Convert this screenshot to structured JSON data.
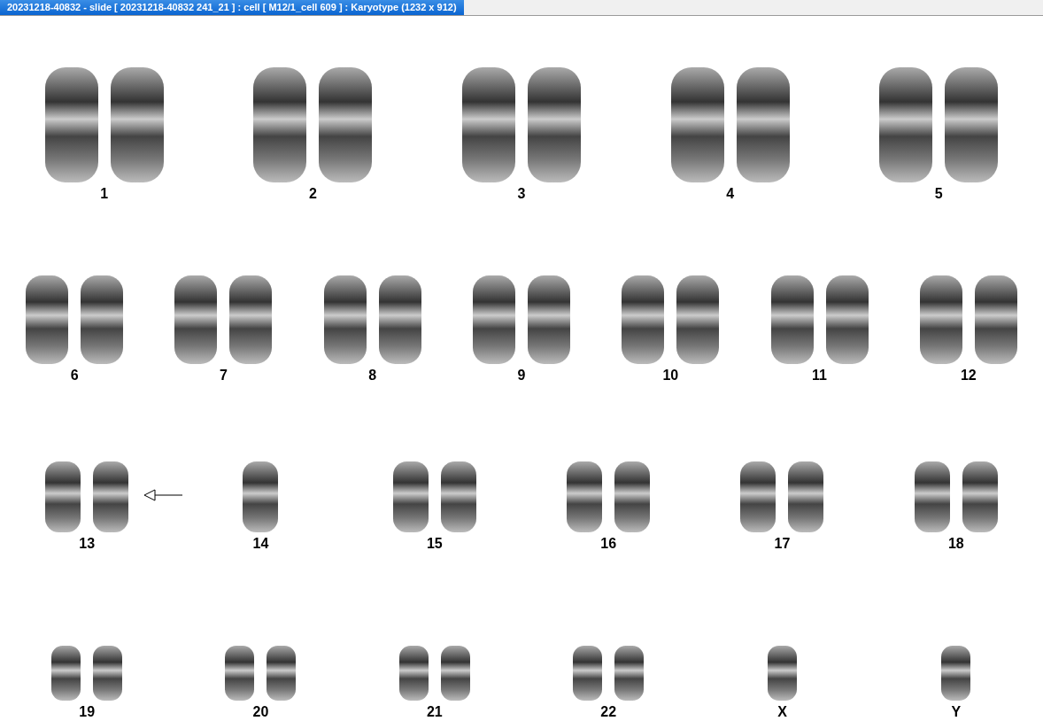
{
  "window": {
    "title": "20231218-40832 - slide [ 20231218-40832 241_21 ] : cell [ M12/1_cell 609 ] : Karyotype  (1232 x 912)"
  },
  "karyotype": {
    "rows": [
      {
        "items": [
          {
            "label": "1",
            "kind": "pair",
            "marked": false
          },
          {
            "label": "2",
            "kind": "pair",
            "marked": false
          },
          {
            "label": "3",
            "kind": "pair",
            "marked": false
          },
          {
            "label": "4",
            "kind": "pair",
            "marked": false
          },
          {
            "label": "5",
            "kind": "pair",
            "marked": false
          }
        ]
      },
      {
        "items": [
          {
            "label": "6",
            "kind": "pair",
            "marked": false
          },
          {
            "label": "7",
            "kind": "pair",
            "marked": false
          },
          {
            "label": "8",
            "kind": "pair",
            "marked": false
          },
          {
            "label": "9",
            "kind": "pair",
            "marked": false
          },
          {
            "label": "10",
            "kind": "pair",
            "marked": false
          },
          {
            "label": "11",
            "kind": "pair",
            "marked": false
          },
          {
            "label": "12",
            "kind": "pair",
            "marked": false
          }
        ]
      },
      {
        "items": [
          {
            "label": "13",
            "kind": "pair",
            "marked": true
          },
          {
            "label": "14",
            "kind": "single",
            "marked": false
          },
          {
            "label": "15",
            "kind": "pair",
            "marked": false
          },
          {
            "label": "16",
            "kind": "pair",
            "marked": false
          },
          {
            "label": "17",
            "kind": "pair",
            "marked": false
          },
          {
            "label": "18",
            "kind": "pair",
            "marked": false
          }
        ]
      },
      {
        "items": [
          {
            "label": "19",
            "kind": "pair",
            "marked": false
          },
          {
            "label": "20",
            "kind": "pair",
            "marked": false
          },
          {
            "label": "21",
            "kind": "pair",
            "marked": false
          },
          {
            "label": "22",
            "kind": "pair",
            "marked": false
          },
          {
            "label": "X",
            "kind": "single",
            "marked": false
          },
          {
            "label": "Y",
            "kind": "single",
            "marked": false
          }
        ]
      }
    ]
  }
}
